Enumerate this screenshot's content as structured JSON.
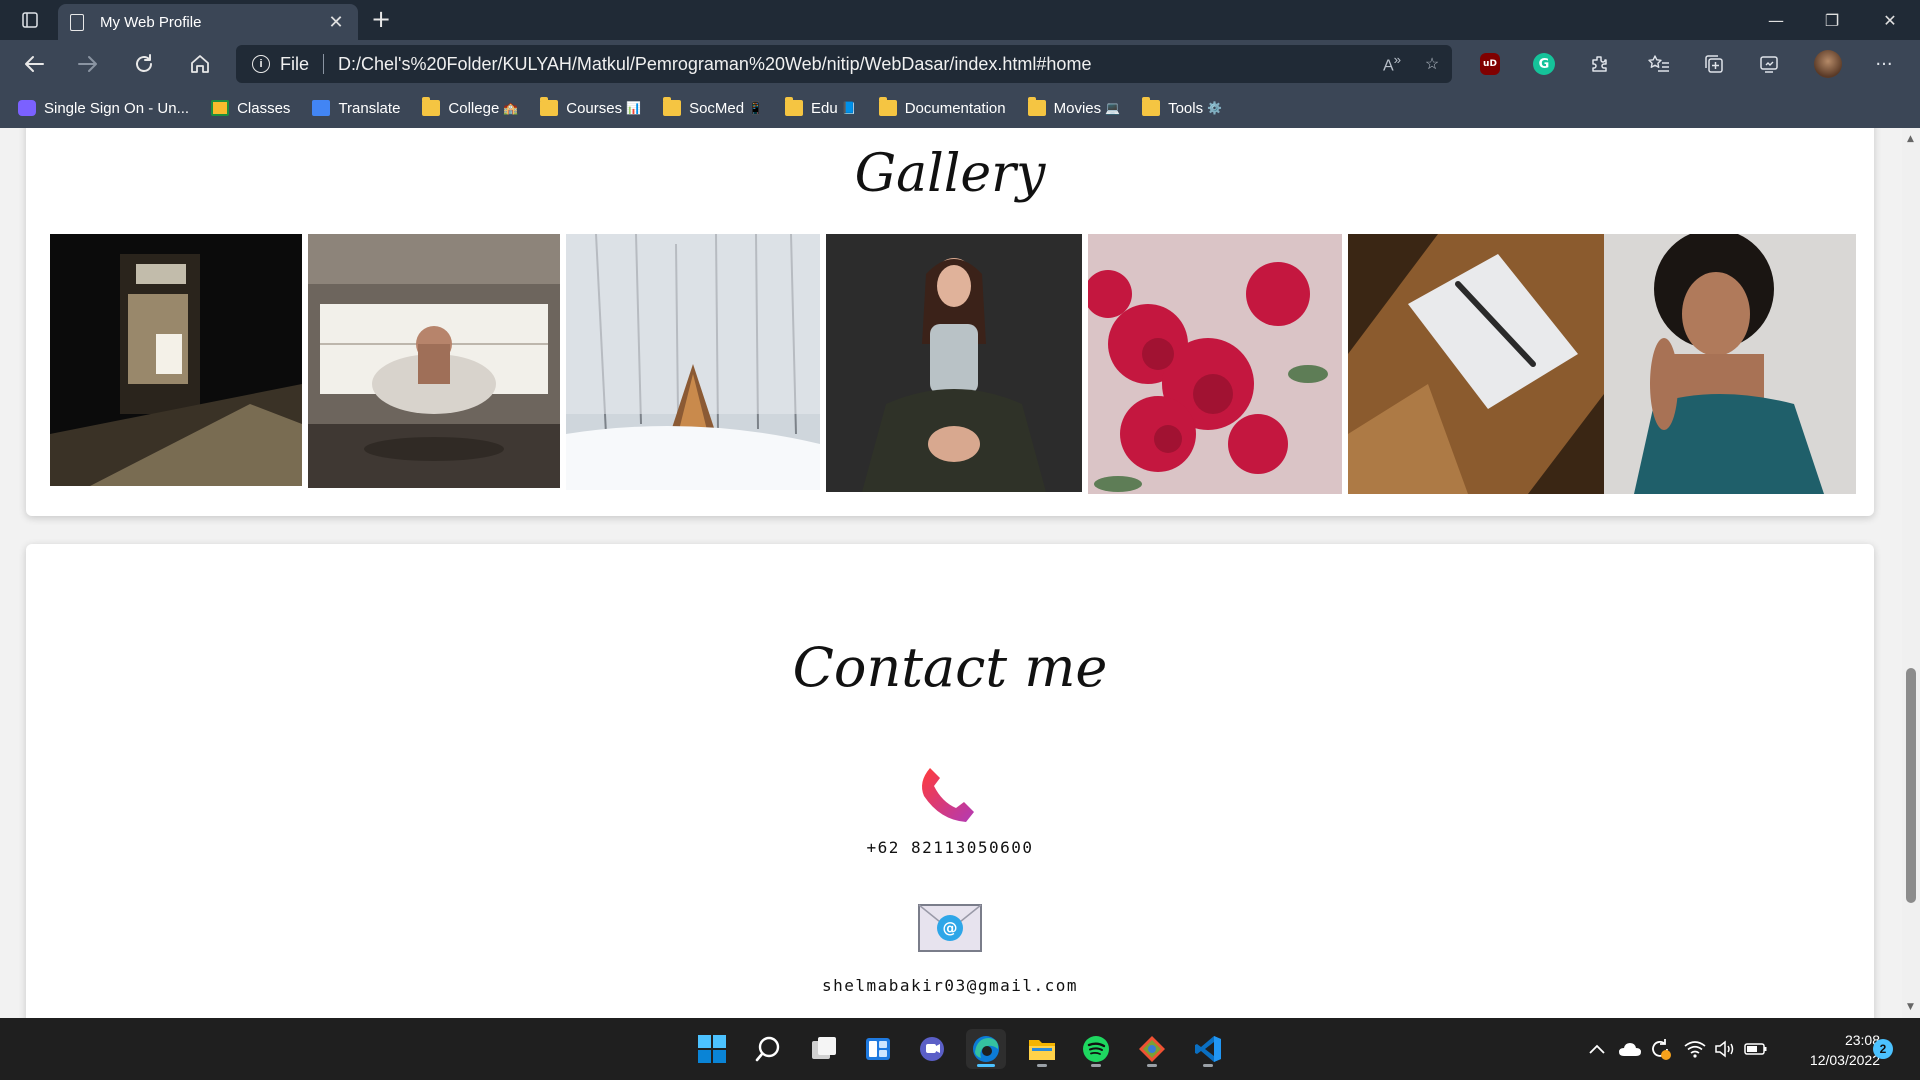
{
  "window": {
    "tab_title": "My Web Profile",
    "minimize": "—",
    "restore": "❐",
    "close": "✕"
  },
  "toolbar": {
    "scheme": "File",
    "url": "D:/Chel's%20Folder/KULYAH/Matkul/Pemrograman%20Web/nitip/WebDasar/index.html#home",
    "ublock_label": "uD",
    "grammarly_label": "G"
  },
  "bookmarks": [
    {
      "label": "Single Sign On - Un...",
      "icon": "sso-icon",
      "emoji": ""
    },
    {
      "label": "Classes",
      "icon": "classroom-icon",
      "emoji": ""
    },
    {
      "label": "Translate",
      "icon": "translate-icon",
      "emoji": ""
    },
    {
      "label": "College",
      "icon": "folder-icon",
      "emoji": "🏫"
    },
    {
      "label": "Courses",
      "icon": "folder-icon",
      "emoji": "📊"
    },
    {
      "label": "SocMed",
      "icon": "folder-icon",
      "emoji": "📱"
    },
    {
      "label": "Edu",
      "icon": "folder-icon",
      "emoji": "📘"
    },
    {
      "label": "Documentation",
      "icon": "folder-icon",
      "emoji": ""
    },
    {
      "label": "Movies",
      "icon": "folder-icon",
      "emoji": "💻"
    },
    {
      "label": "Tools",
      "icon": "folder-icon",
      "emoji": "⚙️"
    }
  ],
  "gallery": {
    "title": "Gallery",
    "photos": [
      {
        "name": "storefront-photo"
      },
      {
        "name": "car-garage-photo"
      },
      {
        "name": "snow-cabin-photo"
      },
      {
        "name": "woman-sitting-photo"
      },
      {
        "name": "red-flowers-photo"
      },
      {
        "name": "notebook-pen-photo"
      },
      {
        "name": "woman-portrait-photo"
      }
    ]
  },
  "contact": {
    "title": "Contact me",
    "phone": "+62 82113050600",
    "email": "shelmabakir03@gmail.com"
  },
  "taskbar": {
    "time": "23:08",
    "date": "12/03/2022",
    "notifications": "2"
  },
  "colors": {
    "browser_frame": "#202a36",
    "toolbar": "#3b4656",
    "accent": "#4cc2ff",
    "phone_icon": "#e8365d"
  }
}
